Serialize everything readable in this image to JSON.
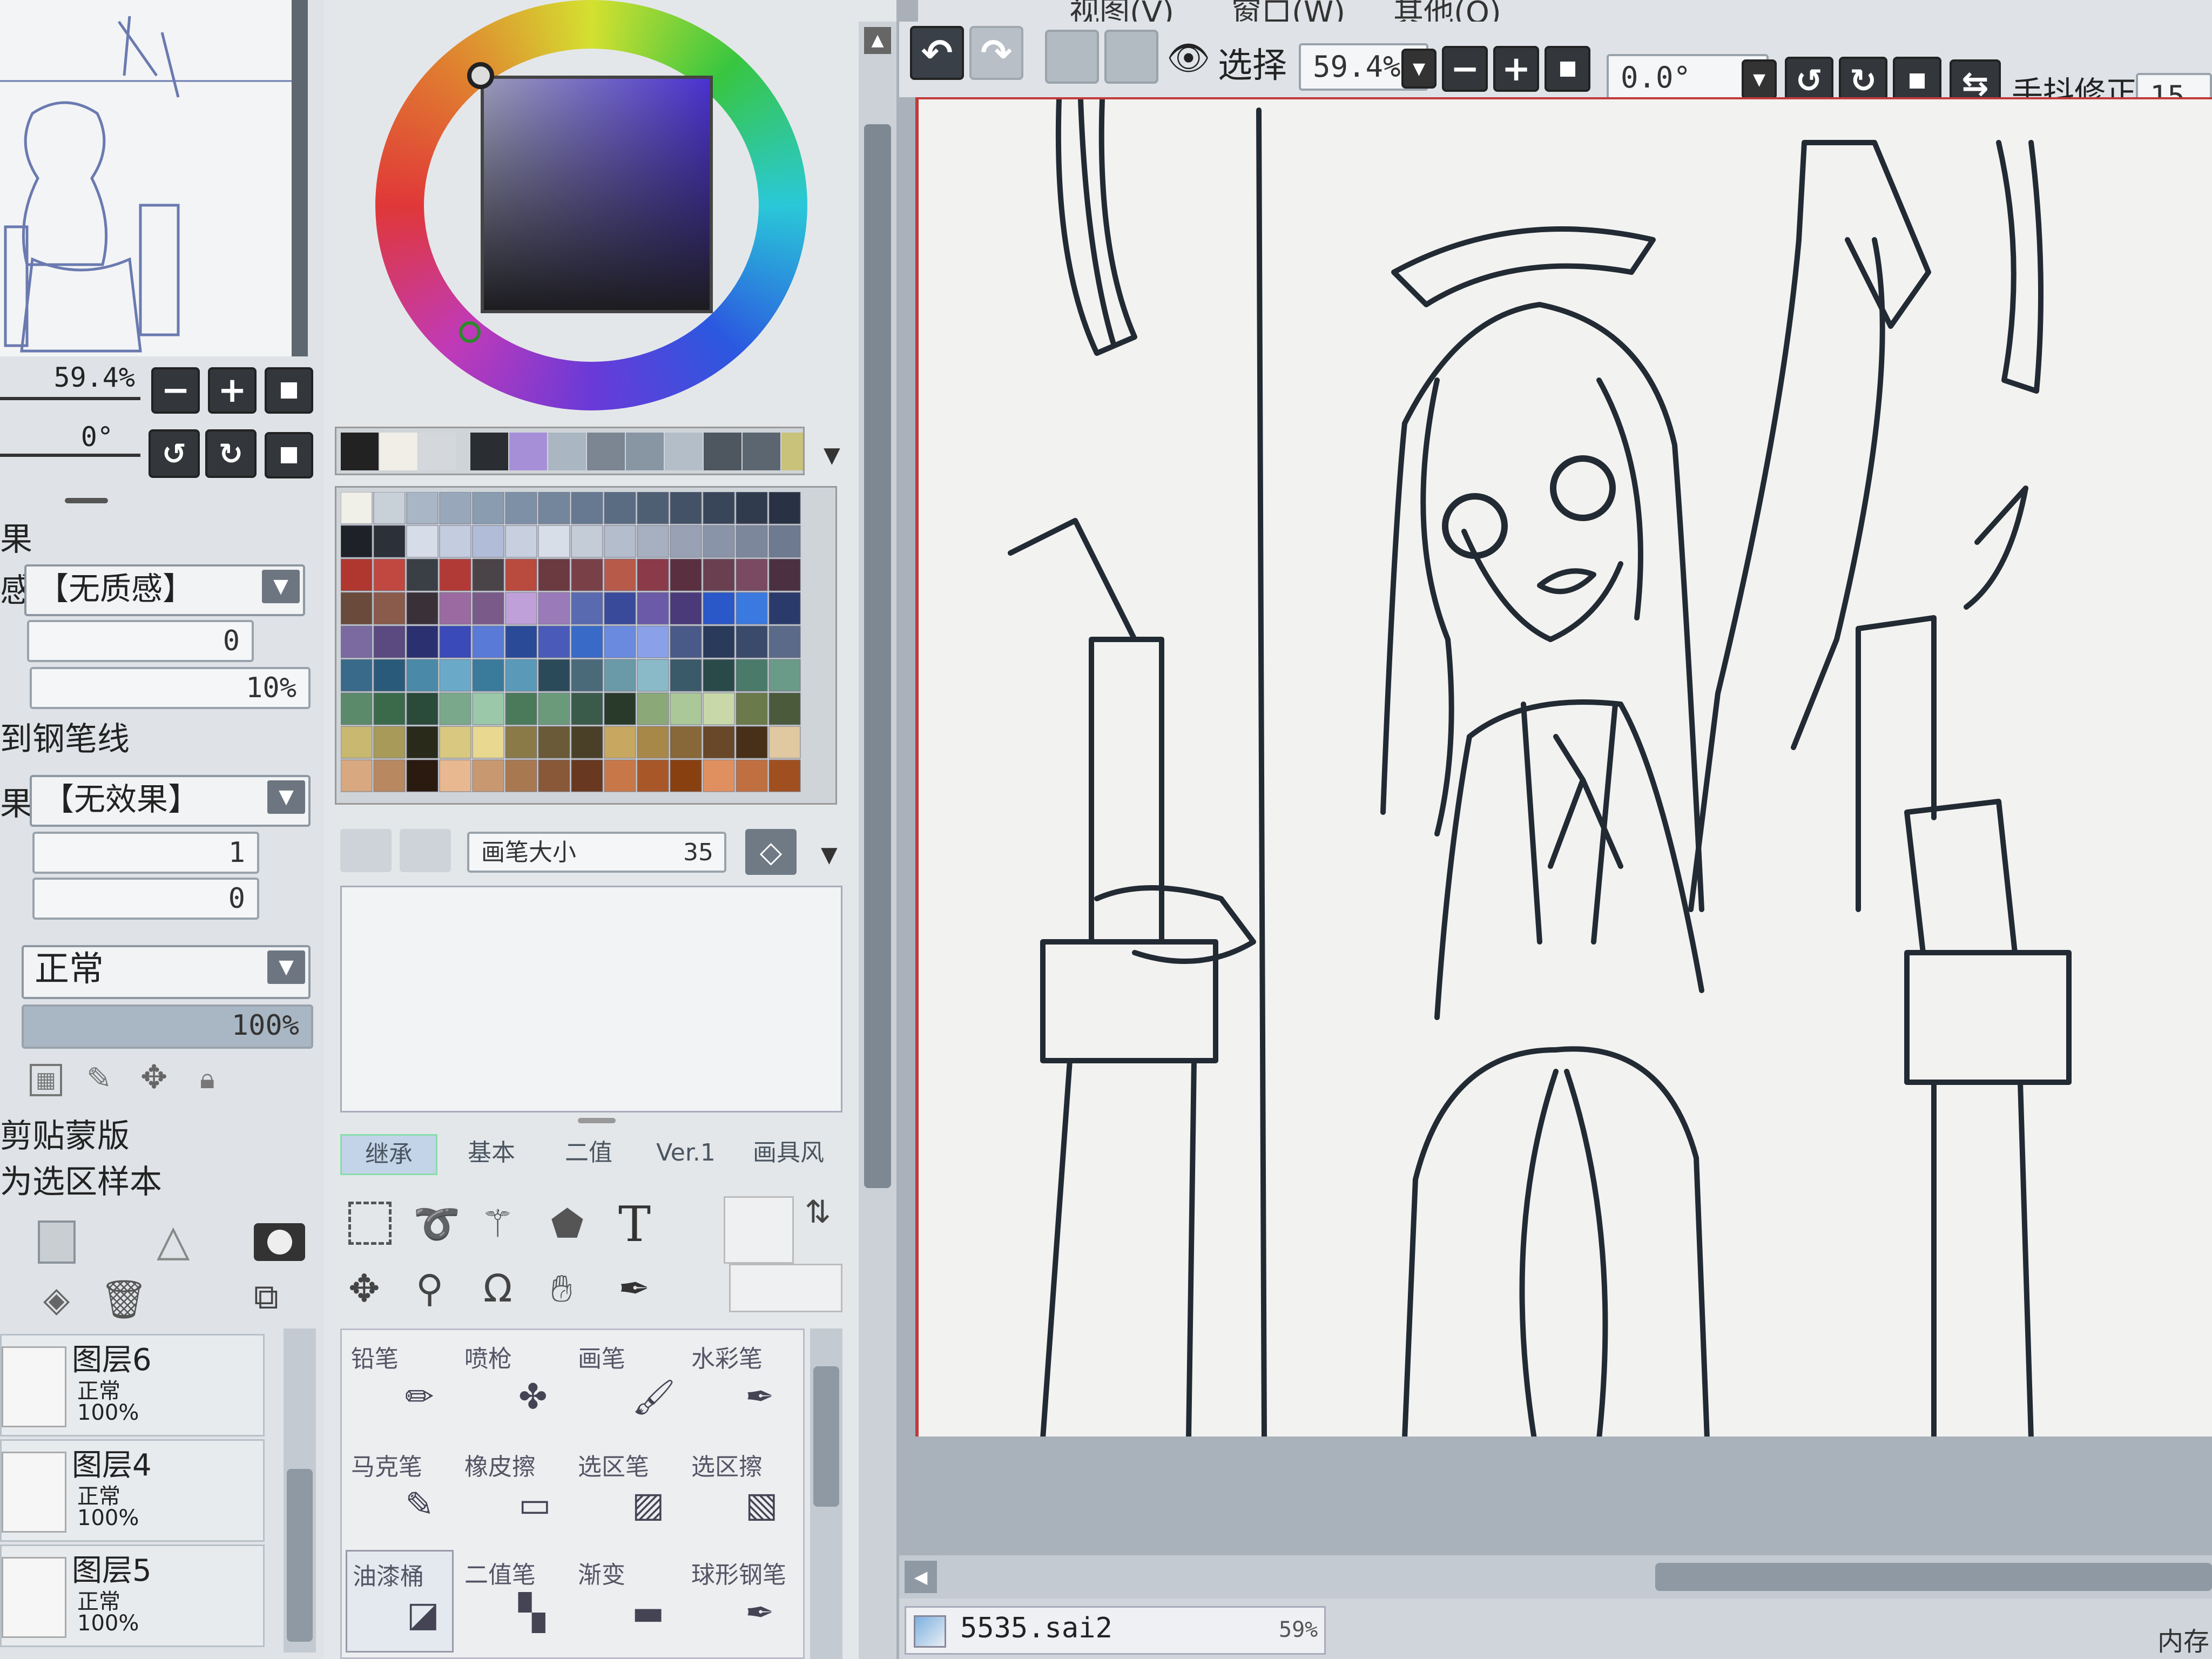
{
  "menu": {
    "items": [
      "视图(V)",
      "窗口(W)",
      "其他(O)"
    ]
  },
  "navigator": {
    "zoom": "59.4%",
    "angle": "0°"
  },
  "brush_settings": {
    "truncated_label_1": "果",
    "texture_prefix": "感",
    "texture_value": "【无质感】",
    "texture_amount": "0",
    "texture_strength": "10%",
    "edge_label": "到钢笔线",
    "effect_prefix": "果",
    "effect_value": "【无效果】",
    "effect_width": "1",
    "effect_strength": "0"
  },
  "layer_settings": {
    "mode_value": "正常",
    "opacity_value": "100%",
    "clip_label": "剪贴蒙版",
    "sample_label": "为选区样本"
  },
  "layers": [
    {
      "name": "图层6",
      "mode": "正常",
      "opacity": "100%"
    },
    {
      "name": "图层4",
      "mode": "正常",
      "opacity": "100%"
    },
    {
      "name": "图层5",
      "mode": "正常",
      "opacity": "100%"
    }
  ],
  "brush_size": {
    "label": "画笔大小",
    "value": "35"
  },
  "tool_tabs": [
    "继承",
    "基本",
    "二值",
    "Ver.1",
    "画具风"
  ],
  "tools": [
    {
      "label": "铅笔"
    },
    {
      "label": "喷枪"
    },
    {
      "label": "画笔"
    },
    {
      "label": "水彩笔"
    },
    {
      "label": "马克笔"
    },
    {
      "label": "橡皮擦"
    },
    {
      "label": "选区笔"
    },
    {
      "label": "选区擦"
    },
    {
      "label": "油漆桶"
    },
    {
      "label": "二值笔"
    },
    {
      "label": "渐变"
    },
    {
      "label": "球形钢笔"
    }
  ],
  "canvas_toolbar": {
    "select_label": "选择",
    "zoom": "59.4%",
    "angle": "0.0°",
    "stabilizer_label": "手抖修正",
    "stabilizer_value": "15"
  },
  "document": {
    "filename": "5535.sai2",
    "zoom": "59%",
    "status_right": "内存"
  },
  "colors": {
    "accent": "#3a7bd5",
    "canvas_bg": "#f2f2f0",
    "line": "#222a33"
  }
}
